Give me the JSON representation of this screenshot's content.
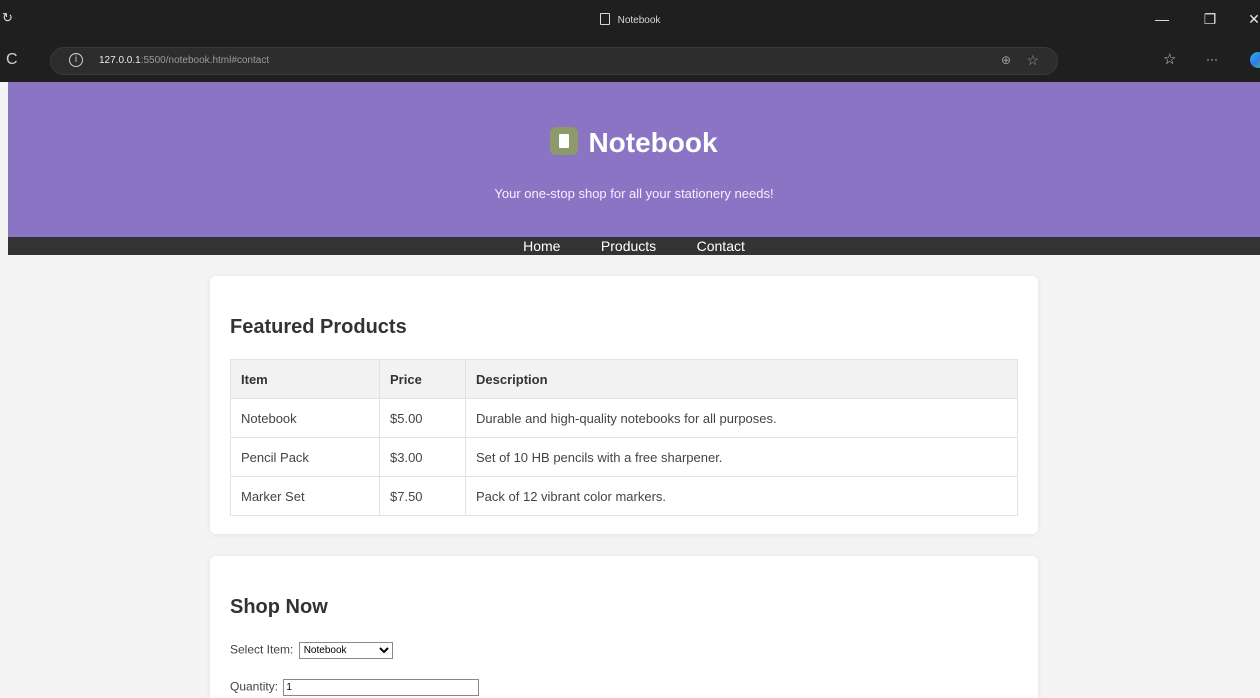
{
  "browser": {
    "tab_title": "Notebook",
    "url_host": "127.0.0.1",
    "url_rest": ":5500/notebook.html#contact"
  },
  "icons": {
    "left_glyph": "↻",
    "reload": "C",
    "info": "i",
    "zoom": "⊕",
    "favorite_star": "☆",
    "favorites": "☆",
    "more": "···",
    "minimize": "—",
    "restore": "❐",
    "close": "✕"
  },
  "header": {
    "brand": "Notebook",
    "tagline": "Your one-stop shop for all your stationery needs!"
  },
  "nav": {
    "home": "Home",
    "products": "Products",
    "contact": "Contact"
  },
  "featured": {
    "title": "Featured Products",
    "columns": [
      "Item",
      "Price",
      "Description"
    ],
    "rows": [
      {
        "item": "Notebook",
        "price": "$5.00",
        "description": "Durable and high-quality notebooks for all purposes."
      },
      {
        "item": "Pencil Pack",
        "price": "$3.00",
        "description": "Set of 10 HB pencils with a free sharpener."
      },
      {
        "item": "Marker Set",
        "price": "$7.50",
        "description": "Pack of 12 vibrant color markers."
      }
    ]
  },
  "shop": {
    "title": "Shop Now",
    "select_label": "Select Item:",
    "selected_item": "Notebook",
    "quantity_label": "Quantity:",
    "quantity_value": "1"
  },
  "colors": {
    "header_bg": "#8b74c4",
    "nav_bg": "#333333",
    "page_bg": "#f4f4f4"
  }
}
